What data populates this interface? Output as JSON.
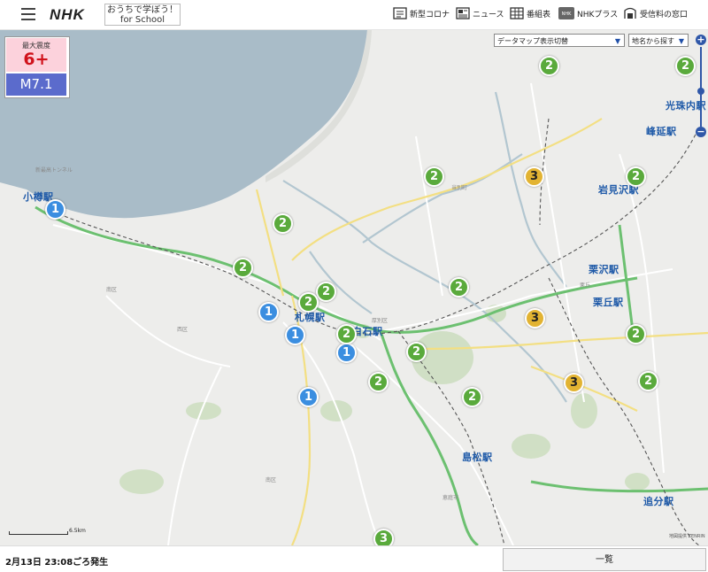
{
  "header": {
    "logo": "NHK",
    "school_line1": "おうちで学ぼう！",
    "school_line2": "for School",
    "nav": [
      {
        "label": "新型コロナ"
      },
      {
        "label": "ニュース"
      },
      {
        "label": "番組表"
      },
      {
        "label": "NHKプラス"
      },
      {
        "label": "受信料の窓口"
      }
    ]
  },
  "intensity": {
    "label": "最大震度",
    "value": "6+",
    "magnitude": "M7.1"
  },
  "controls": {
    "data_map": "データマップ表示切替",
    "place_search": "地名から探す",
    "zoom_in": "+",
    "zoom_out": "−"
  },
  "map": {
    "places": [
      {
        "name": "小樽駅"
      },
      {
        "name": "札幌駅"
      },
      {
        "name": "白石駅"
      },
      {
        "name": "岩見沢駅"
      },
      {
        "name": "峰延駅"
      },
      {
        "name": "光珠内駅"
      },
      {
        "name": "栗沢駅"
      },
      {
        "name": "栗丘駅"
      },
      {
        "name": "島松駅"
      },
      {
        "name": "追分駅"
      }
    ],
    "markers": [
      {
        "level": "1"
      },
      {
        "level": "1"
      },
      {
        "level": "1"
      },
      {
        "level": "1"
      },
      {
        "level": "1"
      },
      {
        "level": "2"
      },
      {
        "level": "2"
      },
      {
        "level": "2"
      },
      {
        "level": "2"
      },
      {
        "level": "2"
      },
      {
        "level": "2"
      },
      {
        "level": "2"
      },
      {
        "level": "2"
      },
      {
        "level": "2"
      },
      {
        "level": "2"
      },
      {
        "level": "2"
      },
      {
        "level": "2"
      },
      {
        "level": "2"
      },
      {
        "level": "2"
      },
      {
        "level": "2"
      },
      {
        "level": "3"
      },
      {
        "level": "3"
      },
      {
        "level": "3"
      }
    ],
    "scale_label": "6.5km",
    "attribution": "地図提供 ZENRIN"
  },
  "footer": {
    "occurrence": "2月13日 23:08ごろ発生",
    "list_button": "一覧"
  },
  "colors": {
    "intensity1": "#3b8ee0",
    "intensity2": "#5aaa3c",
    "intensity3": "#e2b332",
    "sea": "#a9bcc8"
  }
}
